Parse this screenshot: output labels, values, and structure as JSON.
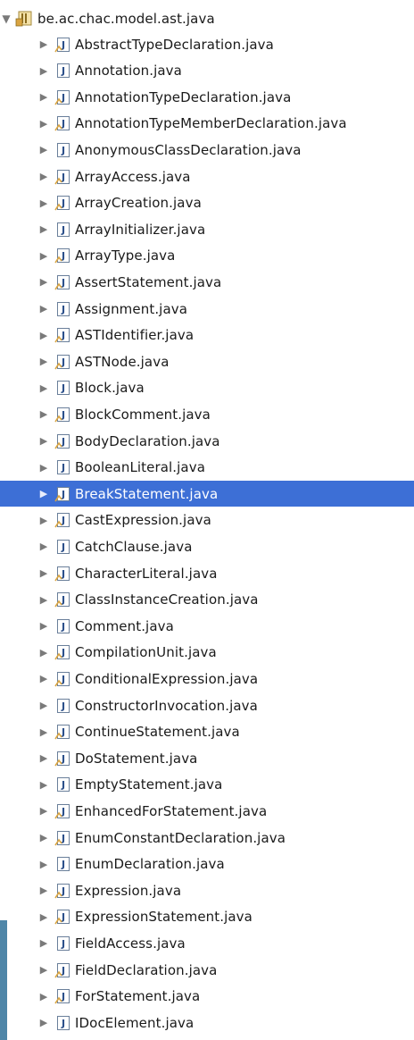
{
  "package": {
    "name": "be.ac.chac.model.ast.java",
    "icon": "package-icon",
    "expanded": true
  },
  "files": [
    {
      "label": "AbstractTypeDeclaration.java"
    },
    {
      "label": "Annotation.java"
    },
    {
      "label": "AnnotationTypeDeclaration.java"
    },
    {
      "label": "AnnotationTypeMemberDeclaration.java"
    },
    {
      "label": "AnonymousClassDeclaration.java"
    },
    {
      "label": "ArrayAccess.java"
    },
    {
      "label": "ArrayCreation.java"
    },
    {
      "label": "ArrayInitializer.java"
    },
    {
      "label": "ArrayType.java"
    },
    {
      "label": "AssertStatement.java"
    },
    {
      "label": "Assignment.java"
    },
    {
      "label": "ASTIdentifier.java"
    },
    {
      "label": "ASTNode.java"
    },
    {
      "label": "Block.java"
    },
    {
      "label": "BlockComment.java"
    },
    {
      "label": "BodyDeclaration.java"
    },
    {
      "label": "BooleanLiteral.java"
    },
    {
      "label": "BreakStatement.java",
      "selected": true
    },
    {
      "label": "CastExpression.java"
    },
    {
      "label": "CatchClause.java"
    },
    {
      "label": "CharacterLiteral.java"
    },
    {
      "label": "ClassInstanceCreation.java"
    },
    {
      "label": "Comment.java"
    },
    {
      "label": "CompilationUnit.java"
    },
    {
      "label": "ConditionalExpression.java"
    },
    {
      "label": "ConstructorInvocation.java"
    },
    {
      "label": "ContinueStatement.java"
    },
    {
      "label": "DoStatement.java"
    },
    {
      "label": "EmptyStatement.java"
    },
    {
      "label": "EnhancedForStatement.java"
    },
    {
      "label": "EnumConstantDeclaration.java"
    },
    {
      "label": "EnumDeclaration.java"
    },
    {
      "label": "Expression.java"
    },
    {
      "label": "ExpressionStatement.java"
    },
    {
      "label": "FieldAccess.java"
    },
    {
      "label": "FieldDeclaration.java"
    },
    {
      "label": "ForStatement.java"
    },
    {
      "label": "IDocElement.java"
    }
  ],
  "colors": {
    "selection": "#3d6fd6",
    "icon_border": "#6a7f9a",
    "icon_j": "#2b4f8a",
    "icon_badge": "#d9a441"
  }
}
